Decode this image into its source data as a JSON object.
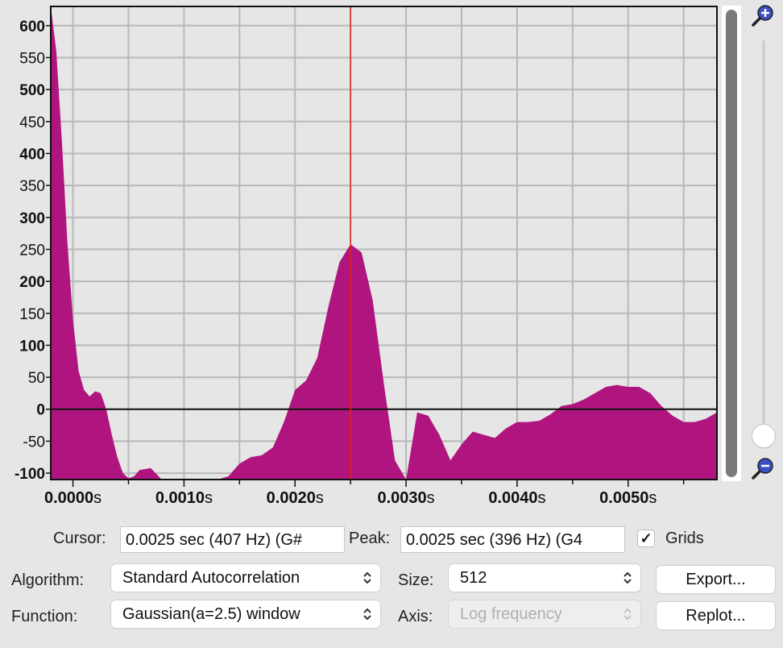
{
  "plot": {
    "x_tick_labels": [
      {
        "num": "0.0000",
        "unit": "s"
      },
      {
        "num": "0.0010",
        "unit": "s"
      },
      {
        "num": "0.0020",
        "unit": "s"
      },
      {
        "num": "0.0030",
        "unit": "s"
      },
      {
        "num": "0.0040",
        "unit": "s"
      },
      {
        "num": "0.0050",
        "unit": "s"
      }
    ],
    "y_tick_labels": [
      "600",
      "550",
      "500",
      "450",
      "400",
      "350",
      "300",
      "250",
      "200",
      "150",
      "100",
      "50",
      "0",
      "-50",
      "-100"
    ],
    "y_bold_labels": [
      "600",
      "500",
      "400",
      "300",
      "200",
      "100",
      "0",
      "-100"
    ],
    "fill_color": "#b0157f",
    "cursor_color": "#e0221c",
    "cursor_time_sec": 0.0025
  },
  "chart_data": {
    "type": "area",
    "x_unit": "s",
    "xlim": [
      -0.0002,
      0.0058
    ],
    "ylim": [
      -110,
      630
    ],
    "x_ticks": [
      0.0,
      0.001,
      0.002,
      0.003,
      0.004,
      0.005
    ],
    "y_ticks": [
      600,
      550,
      500,
      450,
      400,
      350,
      300,
      250,
      200,
      150,
      100,
      50,
      0,
      -50,
      -100
    ],
    "grid": true,
    "x": [
      -0.0002,
      -0.00015,
      -0.0001,
      -5e-05,
      0.0,
      5e-05,
      0.0001,
      0.00015,
      0.0002,
      0.00025,
      0.0003,
      0.00035,
      0.0004,
      0.00045,
      0.0005,
      0.00055,
      0.0006,
      0.0007,
      0.0008,
      0.0009,
      0.001,
      0.0011,
      0.0012,
      0.0013,
      0.0014,
      0.0015,
      0.0016,
      0.0017,
      0.0018,
      0.0019,
      0.002,
      0.0021,
      0.0022,
      0.0023,
      0.0024,
      0.0025,
      0.0026,
      0.0027,
      0.0028,
      0.0029,
      0.003,
      0.0031,
      0.0032,
      0.0033,
      0.0034,
      0.0035,
      0.0036,
      0.0037,
      0.0038,
      0.0039,
      0.004,
      0.0041,
      0.0042,
      0.0043,
      0.0044,
      0.0045,
      0.0046,
      0.0047,
      0.0048,
      0.0049,
      0.005,
      0.0051,
      0.0052,
      0.0053,
      0.0054,
      0.0055,
      0.0056,
      0.0057,
      0.0058
    ],
    "y": [
      630,
      560,
      420,
      260,
      140,
      60,
      30,
      20,
      28,
      25,
      0,
      -40,
      -75,
      -100,
      -108,
      -105,
      -95,
      -92,
      -110,
      -120,
      -128,
      -115,
      -120,
      -128,
      -105,
      -85,
      -75,
      -72,
      -60,
      -20,
      30,
      45,
      80,
      160,
      230,
      258,
      245,
      170,
      40,
      -80,
      -125,
      -5,
      -10,
      -40,
      -80,
      -55,
      -35,
      -40,
      -45,
      -30,
      -20,
      -20,
      -18,
      -8,
      5,
      8,
      15,
      25,
      35,
      38,
      35,
      35,
      25,
      5,
      -10,
      -20,
      -20,
      -15,
      -5
    ]
  },
  "zoom": {
    "in_icon": "zoom-in-icon",
    "out_icon": "zoom-out-icon"
  },
  "cursor": {
    "label": "Cursor:",
    "value": "0.0025 sec (407 Hz) (G#"
  },
  "peak": {
    "label": "Peak:",
    "value": "0.0025 sec (396 Hz) (G4"
  },
  "grids": {
    "label": "Grids",
    "checked": true,
    "check_glyph": "✓"
  },
  "algorithm": {
    "label": "Algorithm:",
    "value": "Standard Autocorrelation"
  },
  "function": {
    "label": "Function:",
    "value": "Gaussian(a=2.5) window"
  },
  "size": {
    "label": "Size:",
    "value": "512"
  },
  "axis": {
    "label": "Axis:",
    "value": "Log frequency",
    "disabled": true
  },
  "buttons": {
    "export": "Export...",
    "replot": "Replot..."
  },
  "icons": {
    "select_chevron": "⌃⌄"
  }
}
